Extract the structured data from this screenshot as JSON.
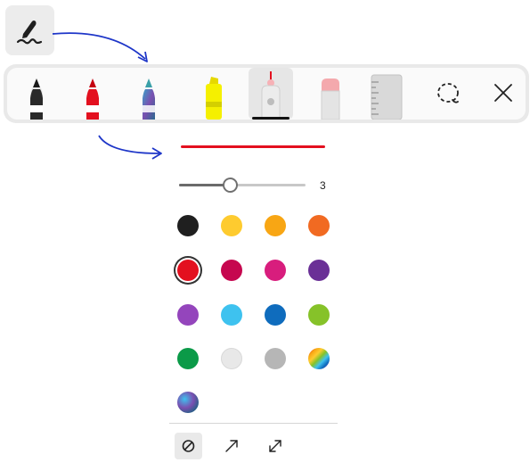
{
  "pen_button": {
    "icon": "pen-signature-icon"
  },
  "toolbar": {
    "tools": [
      {
        "name": "ballpoint-pen",
        "icon": "black-pen-icon",
        "color": "#1a1a1a",
        "selected": false
      },
      {
        "name": "red-pen",
        "icon": "red-pen-icon",
        "color": "#e3101f",
        "selected": false
      },
      {
        "name": "galaxy-pen",
        "icon": "galaxy-pen-icon",
        "color": "#7a5fb3",
        "selected": false
      },
      {
        "name": "highlighter",
        "icon": "yellow-highlighter-icon",
        "color": "#f5f000",
        "selected": false
      },
      {
        "name": "laser-pointer",
        "icon": "laser-pointer-icon",
        "color": "#e3101f",
        "selected": true
      },
      {
        "name": "eraser",
        "icon": "eraser-icon",
        "color": "#f4a9ad",
        "selected": false
      },
      {
        "name": "ruler",
        "icon": "ruler-icon",
        "color": "#d0d0d0",
        "selected": false
      },
      {
        "name": "lasso-select",
        "icon": "lasso-icon",
        "selected": false
      },
      {
        "name": "close",
        "icon": "close-icon",
        "selected": false
      }
    ]
  },
  "flyout": {
    "preview_color": "#e3101f",
    "thickness": {
      "value": "3",
      "fraction": 0.4
    },
    "colors": [
      {
        "name": "black",
        "hex": "#1f1f1f"
      },
      {
        "name": "yellow",
        "hex": "#fecb2f"
      },
      {
        "name": "orange",
        "hex": "#f8a614"
      },
      {
        "name": "dark-orange",
        "hex": "#f16a22"
      },
      {
        "name": "red",
        "hex": "#e3101f",
        "selected": true
      },
      {
        "name": "crimson",
        "hex": "#c6074f"
      },
      {
        "name": "magenta",
        "hex": "#d81d7d"
      },
      {
        "name": "purple",
        "hex": "#6a3096"
      },
      {
        "name": "violet",
        "hex": "#9445bc"
      },
      {
        "name": "light-blue",
        "hex": "#3ec2ef"
      },
      {
        "name": "blue",
        "hex": "#0f6cbd"
      },
      {
        "name": "lime",
        "hex": "#86c229"
      },
      {
        "name": "green",
        "hex": "#0b9a48"
      },
      {
        "name": "light-gray",
        "hex": "#e8e8e8"
      },
      {
        "name": "gray",
        "hex": "#b6b6b6"
      },
      {
        "name": "rainbow",
        "hex": "rainbow"
      },
      {
        "name": "galaxy",
        "hex": "galaxy"
      }
    ],
    "bottom_actions": [
      {
        "name": "no-arrow",
        "icon": "no-arrow-icon",
        "selected": true
      },
      {
        "name": "single-arrow",
        "icon": "arrow-up-right-icon",
        "selected": false
      },
      {
        "name": "double-arrow",
        "icon": "double-arrow-icon",
        "selected": false
      }
    ]
  }
}
